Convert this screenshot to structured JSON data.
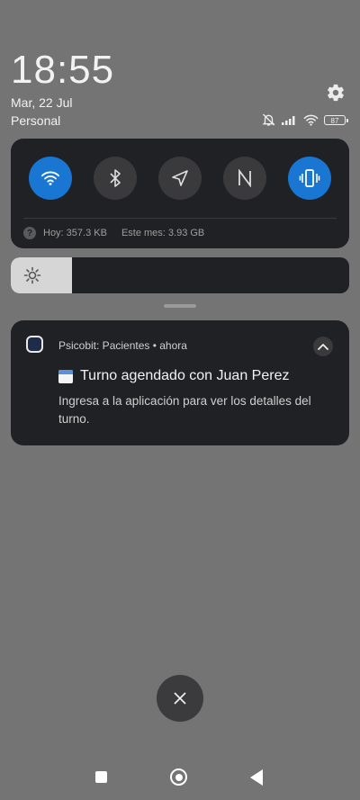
{
  "status": {
    "time": "18:55",
    "date": "Mar, 22 Jul",
    "carrier": "Personal",
    "battery": "87"
  },
  "quick_settings": {
    "tiles": [
      {
        "name": "wifi",
        "active": true
      },
      {
        "name": "bluetooth",
        "active": false
      },
      {
        "name": "location",
        "active": false
      },
      {
        "name": "nfc",
        "active": false
      },
      {
        "name": "vibrate",
        "active": true
      }
    ],
    "usage_today": "Hoy: 357.3 KB",
    "usage_month": "Este mes: 3.93 GB",
    "accent_color": "#1976d2"
  },
  "brightness": {
    "level_percent": 18
  },
  "notification": {
    "app_header": "Psicobit: Pacientes • ahora",
    "title": "Turno agendado con Juan Perez",
    "body": "Ingresa a la aplicación para ver los detalles del turno."
  }
}
